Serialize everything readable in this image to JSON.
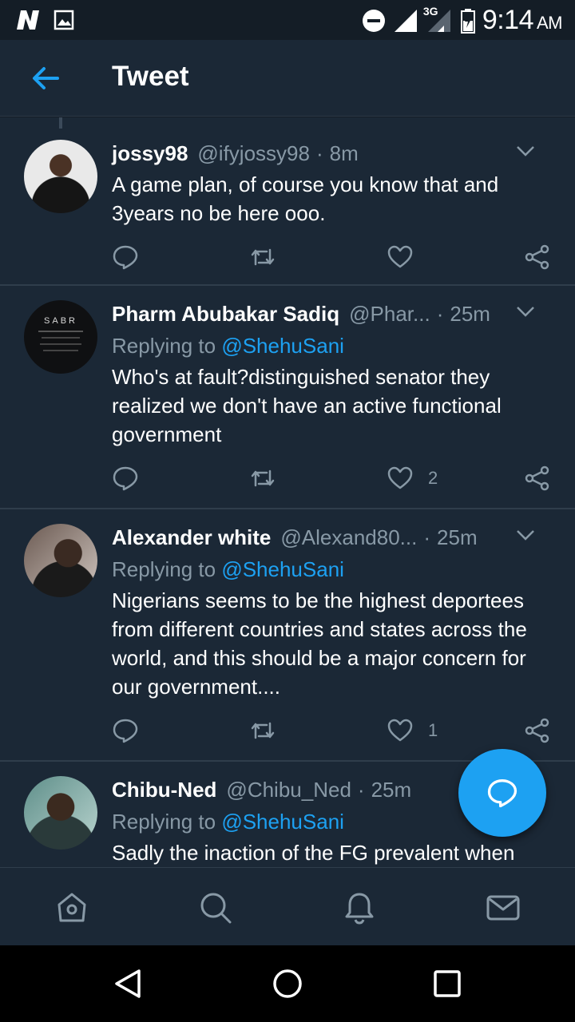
{
  "statusbar": {
    "time": "9:14",
    "ampm": "AM",
    "network": "3G",
    "icons": [
      "netflix-n-icon",
      "gallery-icon",
      "dnd-icon",
      "signal-icon",
      "battery-icon"
    ]
  },
  "header": {
    "title": "Tweet",
    "back_icon": "back-arrow-icon"
  },
  "tweets": [
    {
      "name": "jossy98",
      "handle": "@ifyjossy98",
      "dot": "·",
      "time": "8m",
      "replying_label": "",
      "replying_to": "",
      "text": "A game plan, of course you know that and 3years no be here ooo.",
      "likes": ""
    },
    {
      "name": "Pharm Abubakar Sadiq",
      "handle": "@Phar...",
      "dot": "·",
      "time": "25m",
      "replying_label": "Replying to",
      "replying_to": "@ShehuSani",
      "text": "Who's at fault?distinguished senator they realized we don't have an active functional government",
      "likes": "2",
      "avatar_text": "SABR"
    },
    {
      "name": "Alexander white",
      "handle": "@Alexand80...",
      "dot": "·",
      "time": "25m",
      "replying_label": "Replying to",
      "replying_to": "@ShehuSani",
      "text": "Nigerians seems to be the highest deportees from different countries and states across the world, and this should be a major concern for our government....",
      "likes": "1"
    },
    {
      "name": "Chibu-Ned",
      "handle": "@Chibu_Ned",
      "dot": "·",
      "time": "25m",
      "replying_label": "Replying to",
      "replying_to": "@ShehuSani",
      "text": "Sadly the inaction of the FG prevalent when",
      "likes": ""
    }
  ],
  "colors": {
    "accent": "#1da1f2",
    "background": "#1b2836",
    "muted": "#8899a6"
  },
  "bottom_nav": [
    "home-icon",
    "search-icon",
    "notifications-icon",
    "messages-icon"
  ],
  "system_nav": [
    "back-triangle-icon",
    "home-circle-icon",
    "recents-square-icon"
  ]
}
